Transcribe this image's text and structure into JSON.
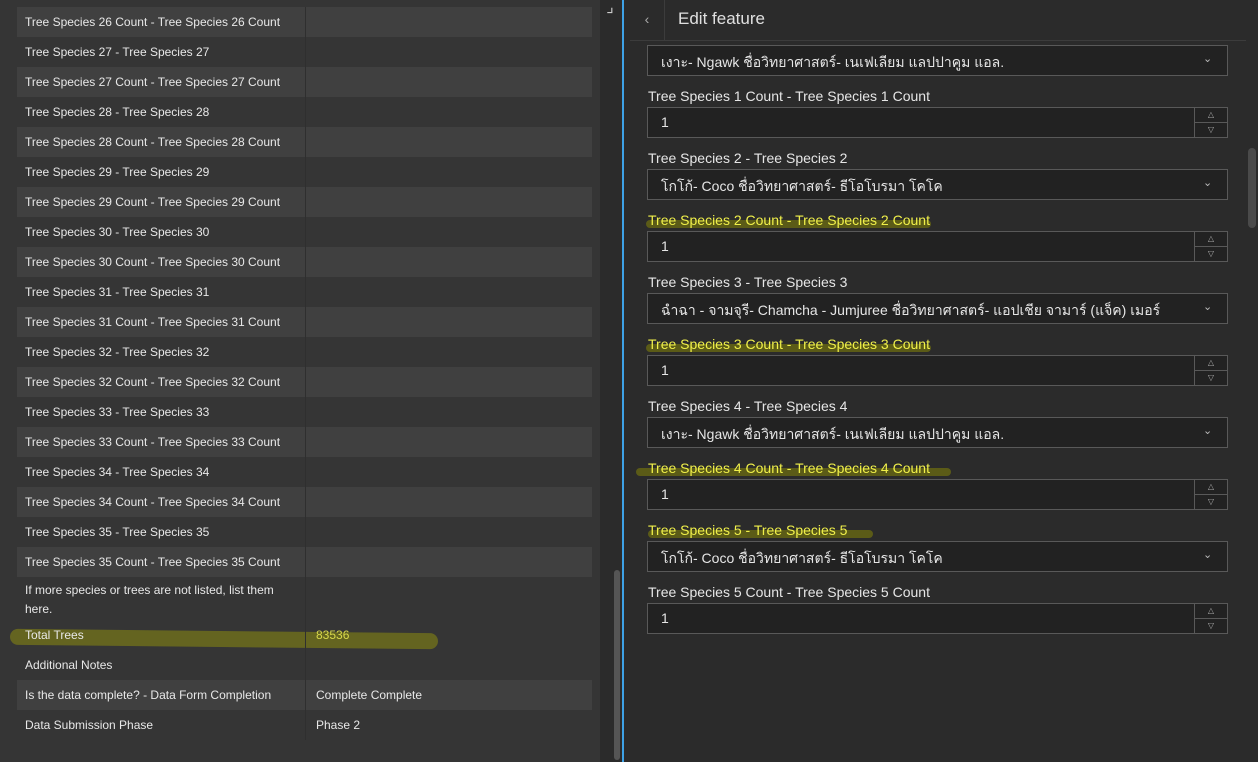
{
  "attribute_rows": [
    {
      "label": "Tree Species 26 Count - Tree Species 26 Count",
      "value": ""
    },
    {
      "label": "Tree Species 27 - Tree Species 27",
      "value": ""
    },
    {
      "label": "Tree Species 27 Count - Tree Species 27 Count",
      "value": ""
    },
    {
      "label": "Tree Species 28 - Tree Species 28",
      "value": ""
    },
    {
      "label": "Tree Species 28 Count - Tree Species 28 Count",
      "value": ""
    },
    {
      "label": "Tree Species 29 - Tree Species 29",
      "value": ""
    },
    {
      "label": "Tree Species 29 Count - Tree Species 29 Count",
      "value": ""
    },
    {
      "label": "Tree Species 30 - Tree Species 30",
      "value": ""
    },
    {
      "label": "Tree Species 30 Count - Tree Species 30 Count",
      "value": ""
    },
    {
      "label": "Tree Species 31 - Tree Species 31",
      "value": ""
    },
    {
      "label": "Tree Species 31 Count - Tree Species 31 Count",
      "value": ""
    },
    {
      "label": "Tree Species 32 - Tree Species 32",
      "value": ""
    },
    {
      "label": "Tree Species 32 Count - Tree Species 32 Count",
      "value": ""
    },
    {
      "label": "Tree Species 33 - Tree Species 33",
      "value": ""
    },
    {
      "label": "Tree Species 33 Count - Tree Species 33 Count",
      "value": ""
    },
    {
      "label": "Tree Species 34 - Tree Species 34",
      "value": ""
    },
    {
      "label": "Tree Species 34 Count - Tree Species 34 Count",
      "value": ""
    },
    {
      "label": "Tree Species 35 - Tree Species 35",
      "value": ""
    },
    {
      "label": "Tree Species 35 Count - Tree Species 35 Count",
      "value": ""
    },
    {
      "label": "If more species or trees are not listed, list them here.",
      "value": ""
    },
    {
      "label": "Total Trees",
      "value": "83536",
      "highlight": true
    },
    {
      "label": "Additional Notes",
      "value": ""
    },
    {
      "label": "Is the data complete? - Data Form Completion",
      "value": "Complete Complete"
    },
    {
      "label": "Data Submission Phase",
      "value": "Phase 2"
    }
  ],
  "edit_panel": {
    "title": "Edit feature",
    "back_icon": "chevron-left-icon",
    "fields": [
      {
        "type": "select",
        "value": "เงาะ- Ngawk ชื่อวิทยาศาสตร์- เนเฟเลียม แลปปาคูม แอล."
      },
      {
        "type": "label",
        "text": "Tree Species 1 Count - Tree Species 1 Count",
        "color": "#e6e6e6"
      },
      {
        "type": "number",
        "value": "1"
      },
      {
        "type": "label",
        "text": "Tree Species 2 - Tree Species 2",
        "color": "#e6e6e6"
      },
      {
        "type": "select",
        "value": "โกโก้- Coco ชื่อวิทยาศาสตร์- ธีโอโบรมา โคโค"
      },
      {
        "type": "label",
        "text": "Tree Species 2 Count - Tree Species 2 Count",
        "color": "#f0f04a"
      },
      {
        "type": "number",
        "value": "1"
      },
      {
        "type": "label",
        "text": "Tree Species 3 - Tree Species 3",
        "color": "#e6e6e6"
      },
      {
        "type": "select",
        "value": "ฉำฉา - จามจุรี- Chamcha - Jumjuree ชื่อวิทยาศาสตร์- แอปเชีย จามาร์ (แจ็ค) เมอร์"
      },
      {
        "type": "label",
        "text": "Tree Species 3 Count - Tree Species 3 Count",
        "color": "#f0f04a"
      },
      {
        "type": "number",
        "value": "1"
      },
      {
        "type": "label",
        "text": "Tree Species 4 - Tree Species 4",
        "color": "#e6e6e6"
      },
      {
        "type": "select",
        "value": "เงาะ- Ngawk ชื่อวิทยาศาสตร์- เนเฟเลียม แลปปาคูม แอล."
      },
      {
        "type": "label",
        "text": "Tree Species 4 Count - Tree Species 4 Count",
        "color": "#f0f04a"
      },
      {
        "type": "number",
        "value": "1"
      },
      {
        "type": "label",
        "text": "Tree Species 5 - Tree Species 5",
        "color": "#f0f04a"
      },
      {
        "type": "select",
        "value": "โกโก้- Coco ชื่อวิทยาศาสตร์- ธีโอโบรมา โคโค"
      },
      {
        "type": "label",
        "text": "Tree Species 5 Count - Tree Species 5 Count",
        "color": "#e6e6e6"
      },
      {
        "type": "number",
        "value": "1"
      }
    ]
  },
  "icons": {
    "select_chevron": "chevron-down-icon",
    "spinner_up": "chevron-up-icon",
    "spinner_down": "chevron-down-icon",
    "collapse": "collapse-corner-icon"
  },
  "colors": {
    "accent_divider": "#3ea2e6",
    "highlight_text": "#f0f04a",
    "highlight_value": "#d8d84a"
  }
}
